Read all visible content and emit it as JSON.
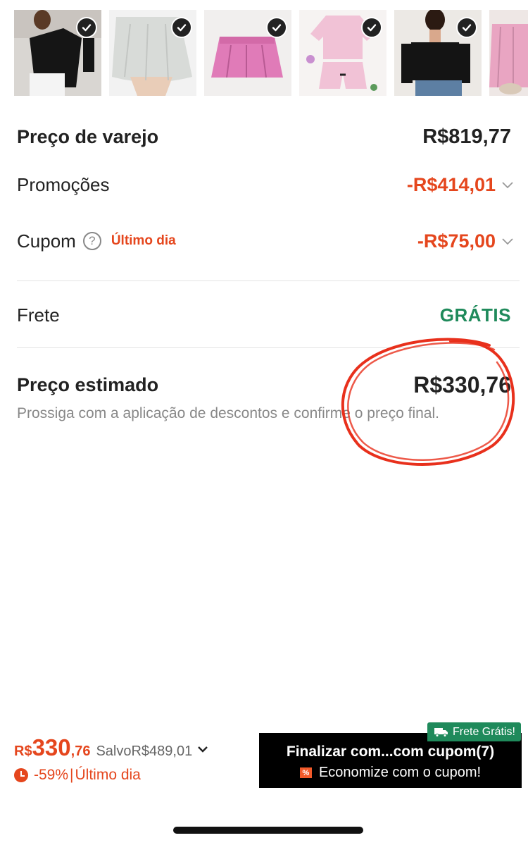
{
  "thumbnails": [
    {
      "name": "black-asymmetric-top",
      "checked": true
    },
    {
      "name": "grey-pleated-skirt",
      "checked": true
    },
    {
      "name": "pink-pleated-skirt",
      "checked": true
    },
    {
      "name": "pink-pajama-set",
      "checked": true
    },
    {
      "name": "black-cold-shoulder-top",
      "checked": true
    },
    {
      "name": "pink-skirt-partial",
      "checked": false
    }
  ],
  "summary": {
    "retail_label": "Preço de varejo",
    "retail_value": "R$819,77",
    "promos_label": "Promoções",
    "promos_value": "-R$414,01",
    "coupon_label": "Cupom",
    "coupon_help": "?",
    "coupon_tag": "Último dia",
    "coupon_value": "-R$75,00",
    "shipping_label": "Frete",
    "shipping_value": "GRÁTIS",
    "estimated_label": "Preço estimado",
    "estimated_value": "R$330,76",
    "estimated_note": "Prossiga com a aplicação de descontos e confirme o preço final."
  },
  "bottom": {
    "currency": "R$",
    "price_int": "330",
    "price_dec": ",76",
    "saved": "SalvoR$489,01",
    "discount": "-59%",
    "separator": "|",
    "deadline": "Último dia",
    "free_shipping_badge": "Frete Grátis!",
    "checkout_title": "Finalizar com...com cupom(7)",
    "checkout_sub": "Economize com o cupom!",
    "coupon_icon_glyph": "%"
  },
  "colors": {
    "accent_red": "#e5461d",
    "green": "#1f8a5b",
    "scribble": "#e8301c"
  }
}
